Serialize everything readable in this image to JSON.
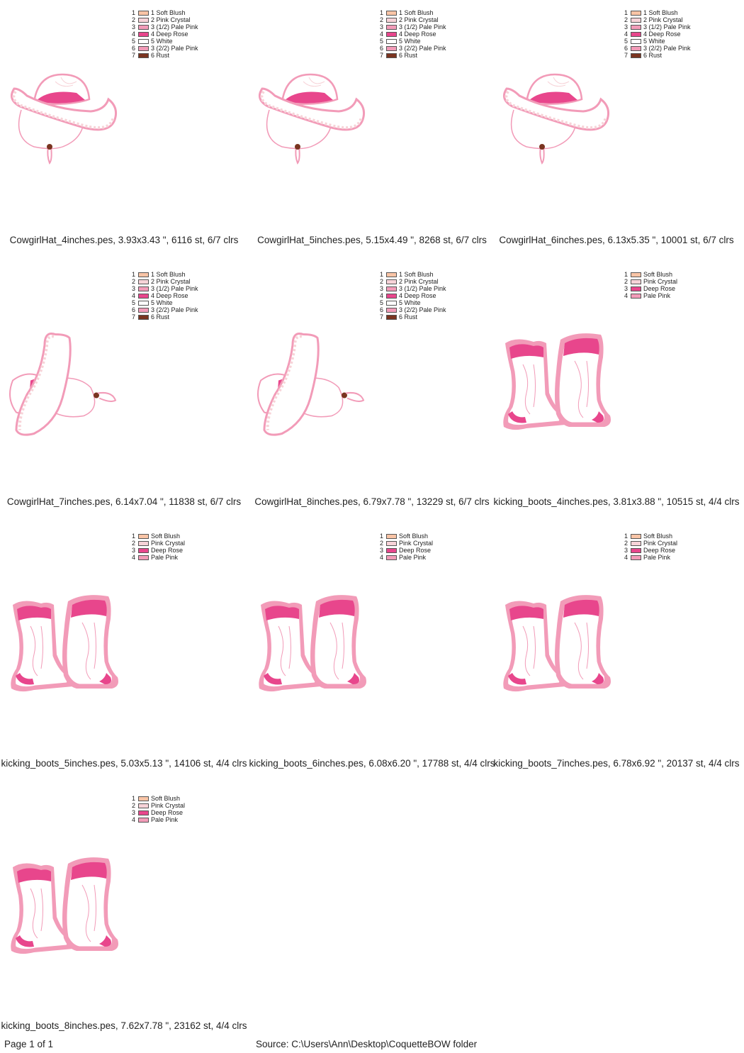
{
  "legend_sets": {
    "hat": [
      {
        "num": "1",
        "label": "1 Soft Blush",
        "color": "#f9c4a6"
      },
      {
        "num": "2",
        "label": "2 Pink Crystal",
        "color": "#f7d3d8"
      },
      {
        "num": "3",
        "label": "3 (1/2) Pale Pink",
        "color": "#f29bb8"
      },
      {
        "num": "4",
        "label": "4 Deep Rose",
        "color": "#e8468c"
      },
      {
        "num": "5",
        "label": "5 White",
        "color": "#ffffff"
      },
      {
        "num": "6",
        "label": "3 (2/2) Pale Pink",
        "color": "#f29bb8"
      },
      {
        "num": "7",
        "label": "6 Rust",
        "color": "#7a3420"
      }
    ],
    "boots": [
      {
        "num": "1",
        "label": "Soft Blush",
        "color": "#f9c4a6"
      },
      {
        "num": "2",
        "label": "Pink Crystal",
        "color": "#f7d3d8"
      },
      {
        "num": "3",
        "label": "Deep Rose",
        "color": "#e8468c"
      },
      {
        "num": "4",
        "label": "Pale Pink",
        "color": "#f29bb8"
      }
    ]
  },
  "designs": [
    {
      "caption": "CowgirlHat_4inches.pes, 3.93x3.43 \", 6116 st, 6/7 clrs",
      "kind": "hat"
    },
    {
      "caption": "CowgirlHat_5inches.pes, 5.15x4.49 \", 8268 st, 6/7 clrs",
      "kind": "hat"
    },
    {
      "caption": "CowgirlHat_6inches.pes, 6.13x5.35 \", 10001 st, 6/7 clrs",
      "kind": "hat"
    },
    {
      "caption": "CowgirlHat_7inches.pes, 6.14x7.04 \", 11838 st, 6/7 clrs",
      "kind": "hat-rotated"
    },
    {
      "caption": "CowgirlHat_8inches.pes, 6.79x7.78 \", 13229 st, 6/7 clrs",
      "kind": "hat-rotated"
    },
    {
      "caption": "kicking_boots_4inches.pes, 3.81x3.88 \", 10515 st, 4/4 clrs",
      "kind": "boots"
    },
    {
      "caption": "kicking_boots_5inches.pes, 5.03x5.13 \", 14106 st, 4/4 clrs",
      "kind": "boots"
    },
    {
      "caption": "kicking_boots_6inches.pes, 6.08x6.20 \", 17788 st, 4/4 clrs",
      "kind": "boots"
    },
    {
      "caption": "kicking_boots_7inches.pes, 6.78x6.92 \", 20137 st, 4/4 clrs",
      "kind": "boots"
    },
    {
      "caption": "kicking_boots_8inches.pes, 7.62x7.78 \", 23162 st, 4/4 clrs",
      "kind": "boots"
    }
  ],
  "footer": {
    "page": "Page 1 of 1",
    "source": "Source: C:\\Users\\Ann\\Desktop\\CoquetteBOW folder"
  }
}
